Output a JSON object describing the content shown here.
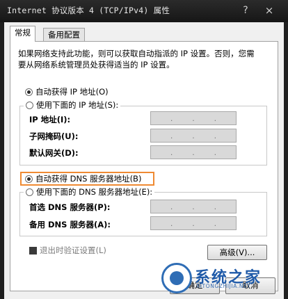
{
  "window": {
    "title": "Internet 协议版本 4 (TCP/IPv4) 属性",
    "help_glyph": "?",
    "close_glyph": "×"
  },
  "tabs": [
    {
      "label": "常规",
      "active": true
    },
    {
      "label": "备用配置",
      "active": false
    }
  ],
  "general": {
    "intro": "如果网络支持此功能，则可以获取自动指派的 IP 设置。否则，您需要从网络系统管理员处获得适当的 IP 设置。",
    "ip_auto": {
      "label": "自动获得 IP 地址(O)",
      "checked": true
    },
    "ip_manual": {
      "label": "使用下面的 IP 地址(S):",
      "checked": false
    },
    "ip_fields": [
      {
        "label": "IP 地址(I):"
      },
      {
        "label": "子网掩码(U):"
      },
      {
        "label": "默认网关(D):"
      }
    ],
    "dns_auto": {
      "label": "自动获得 DNS 服务器地址(B)",
      "checked": true
    },
    "dns_manual": {
      "label": "使用下面的 DNS 服务器地址(E):",
      "checked": false
    },
    "dns_fields": [
      {
        "label": "首选 DNS 服务器(P):"
      },
      {
        "label": "备用 DNS 服务器(A):"
      }
    ],
    "validate_on_exit": {
      "label": "退出时验证设置(L)",
      "checked": true
    },
    "advanced_button": "高级(V)..."
  },
  "footer": {
    "ok_button": "确定",
    "cancel_button": "取消"
  },
  "watermark": {
    "text": "系统之家",
    "url": "XITONGZHIJIA.NET"
  }
}
